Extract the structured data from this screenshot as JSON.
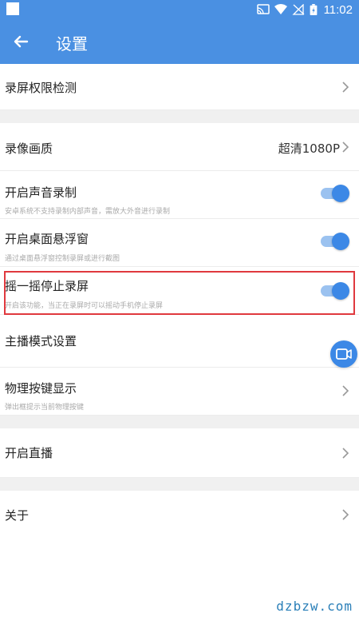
{
  "status_bar": {
    "time": "11:02",
    "icons": [
      "cast-icon",
      "wifi-icon",
      "no-signal-icon",
      "battery-charging-icon"
    ]
  },
  "app_bar": {
    "title": "设置"
  },
  "settings": {
    "permission_check": {
      "label": "录屏权限检测"
    },
    "video_quality": {
      "label": "录像画质",
      "value": "超清1080P"
    },
    "audio_record": {
      "label": "开启声音录制",
      "description": "安卓系统不支持录制内部声音，需放大外音进行录制",
      "enabled": true
    },
    "floating_window": {
      "label": "开启桌面悬浮窗",
      "description": "通过桌面悬浮窗控制录屏或进行截图",
      "enabled": true
    },
    "shake_stop": {
      "label": "摇一摇停止录屏",
      "description": "开启该功能，当正在录屏时可以摇动手机停止录屏",
      "enabled": true
    },
    "anchor_mode": {
      "label": "主播模式设置"
    },
    "physical_keys": {
      "label": "物理按键显示",
      "description": "弹出框提示当前物理按键"
    },
    "live_stream": {
      "label": "开启直播"
    },
    "about": {
      "label": "关于"
    }
  },
  "watermark": "dzbzw.com",
  "colors": {
    "primary": "#4a90e2",
    "toggle_on": "#3c88e6",
    "highlight": "#e0393e"
  }
}
